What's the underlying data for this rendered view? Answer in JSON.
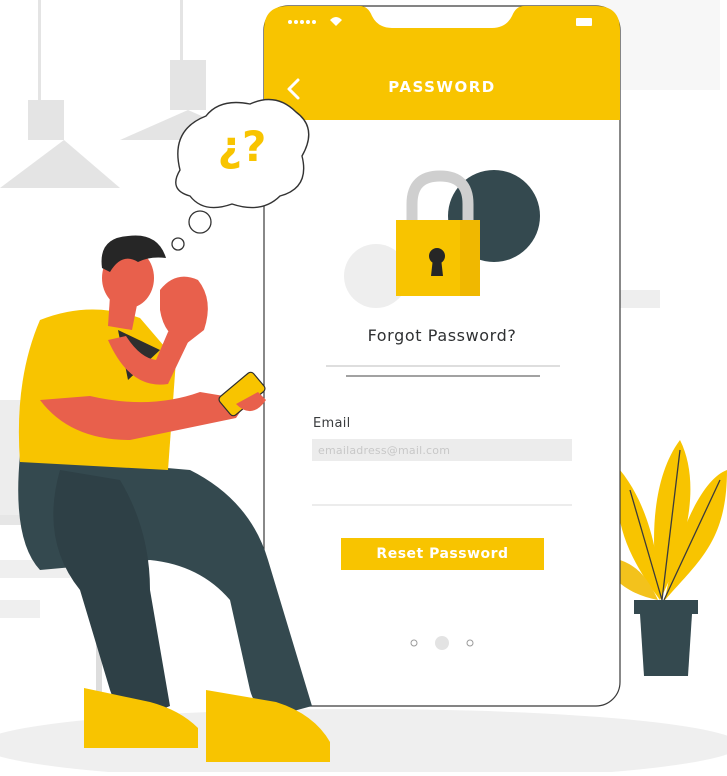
{
  "header": {
    "title": "PASSWORD",
    "back_icon": "chevron-left-icon"
  },
  "main": {
    "heading": "Forgot Password?",
    "email_label": "Email",
    "email_placeholder": "emailadress@mail.com",
    "email_value": "",
    "reset_button_label": "Reset Password"
  },
  "pagination": {
    "dot_count": 3,
    "active_index": 1
  },
  "thought_bubble": {
    "text": "¿?"
  },
  "colors": {
    "accent": "#f8c400",
    "dark": "#34494f",
    "skin": "#e8604c",
    "phone_bg": "#ffffff"
  },
  "icons": [
    "chevron-left-icon",
    "padlock-icon",
    "signal-icon",
    "wifi-icon",
    "battery-icon"
  ]
}
